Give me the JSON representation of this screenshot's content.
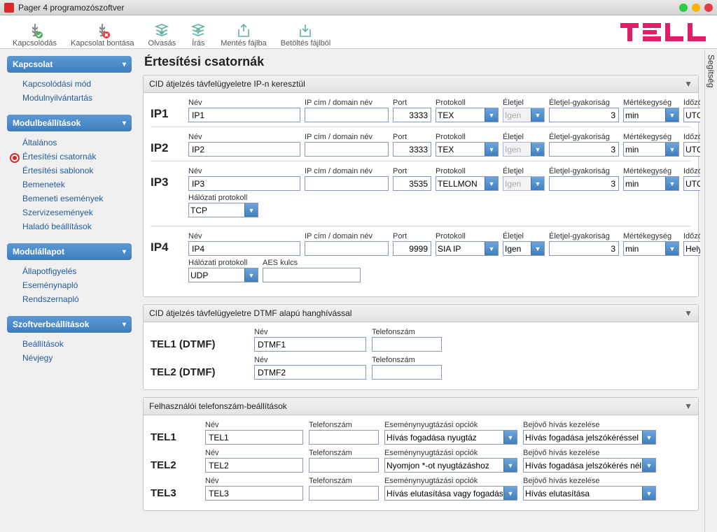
{
  "window": {
    "title": "Pager 4 programozószoftver"
  },
  "toolbar": {
    "connect": "Kapcsolódás",
    "disconnect": "Kapcsolat bontása",
    "read": "Olvasás",
    "write": "Írás",
    "save": "Mentés fájlba",
    "load": "Betöltés fájlból"
  },
  "sidebar": {
    "sections": [
      {
        "title": "Kapcsolat",
        "items": [
          "Kapcsolódási mód",
          "Modulnyilvántartás"
        ],
        "active": -1
      },
      {
        "title": "Modulbeállítások",
        "items": [
          "Általános",
          "Értesítési csatornák",
          "Értesítési sablonok",
          "Bemenetek",
          "Bemeneti események",
          "Szervizesemények",
          "Haladó beállítások"
        ],
        "active": 1
      },
      {
        "title": "Modulállapot",
        "items": [
          "Állapotfigyelés",
          "Eseménynapló",
          "Rendszernapló"
        ],
        "active": -1
      },
      {
        "title": "Szoftverbeállítások",
        "items": [
          "Beállítások",
          "Névjegy"
        ],
        "active": -1
      }
    ]
  },
  "page": {
    "title": "Értesítési csatornák",
    "help_label": "Segítség"
  },
  "labels": {
    "name": "Név",
    "ipdomain": "IP cím / domain név",
    "port": "Port",
    "protocol": "Protokoll",
    "heartbeat": "Életjel",
    "heartbeat_freq": "Életjel-gyakoriság",
    "unit": "Mértékegység",
    "timezone": "Időzóna",
    "net_protocol": "Hálózati protokoll",
    "aes_key": "AES kulcs",
    "phone": "Telefonszám",
    "ack_options": "Eseménynyugtázási opciók",
    "incoming": "Bejövő hívás kezelése"
  },
  "panels": {
    "ip_title": "CID átjelzés távfelügyeletre IP-n keresztül",
    "dtmf_title": "CID átjelzés távfelügyeletre DTMF alapú hanghívással",
    "user_phones_title": "Felhasználói telefonszám-beállítások"
  },
  "ip": [
    {
      "row": "IP1",
      "name": "IP1",
      "ip": "",
      "port": "3333",
      "protocol": "TEX",
      "heartbeat": "Igen",
      "heartbeat_disabled": true,
      "freq": "3",
      "unit": "min",
      "tz": "UTC",
      "net": "",
      "aes": ""
    },
    {
      "row": "IP2",
      "name": "IP2",
      "ip": "",
      "port": "3333",
      "protocol": "TEX",
      "heartbeat": "Igen",
      "heartbeat_disabled": true,
      "freq": "3",
      "unit": "min",
      "tz": "UTC",
      "net": "",
      "aes": ""
    },
    {
      "row": "IP3",
      "name": "IP3",
      "ip": "",
      "port": "3535",
      "protocol": "TELLMON",
      "heartbeat": "Igen",
      "heartbeat_disabled": true,
      "freq": "3",
      "unit": "min",
      "tz": "UTC",
      "net": "TCP",
      "aes": ""
    },
    {
      "row": "IP4",
      "name": "IP4",
      "ip": "",
      "port": "9999",
      "protocol": "SIA IP",
      "heartbeat": "Igen",
      "heartbeat_disabled": false,
      "freq": "3",
      "unit": "min",
      "tz": "Helyi",
      "net": "UDP",
      "aes": ""
    }
  ],
  "dtmf": [
    {
      "row": "TEL1 (DTMF)",
      "name": "DTMF1",
      "phone": ""
    },
    {
      "row": "TEL2 (DTMF)",
      "name": "DTMF2",
      "phone": ""
    }
  ],
  "tel": [
    {
      "row": "TEL1",
      "name": "TEL1",
      "phone": "",
      "ack": "Hívás fogadása nyugtáz",
      "incoming": "Hívás fogadása jelszókéréssel"
    },
    {
      "row": "TEL2",
      "name": "TEL2",
      "phone": "",
      "ack": "Nyomjon *-ot nyugtázáshoz",
      "incoming": "Hívás fogadása jelszókérés nélkül"
    },
    {
      "row": "TEL3",
      "name": "TEL3",
      "phone": "",
      "ack": "Hívás elutasítása vagy fogadása",
      "incoming": "Hívás elutasítása"
    }
  ]
}
